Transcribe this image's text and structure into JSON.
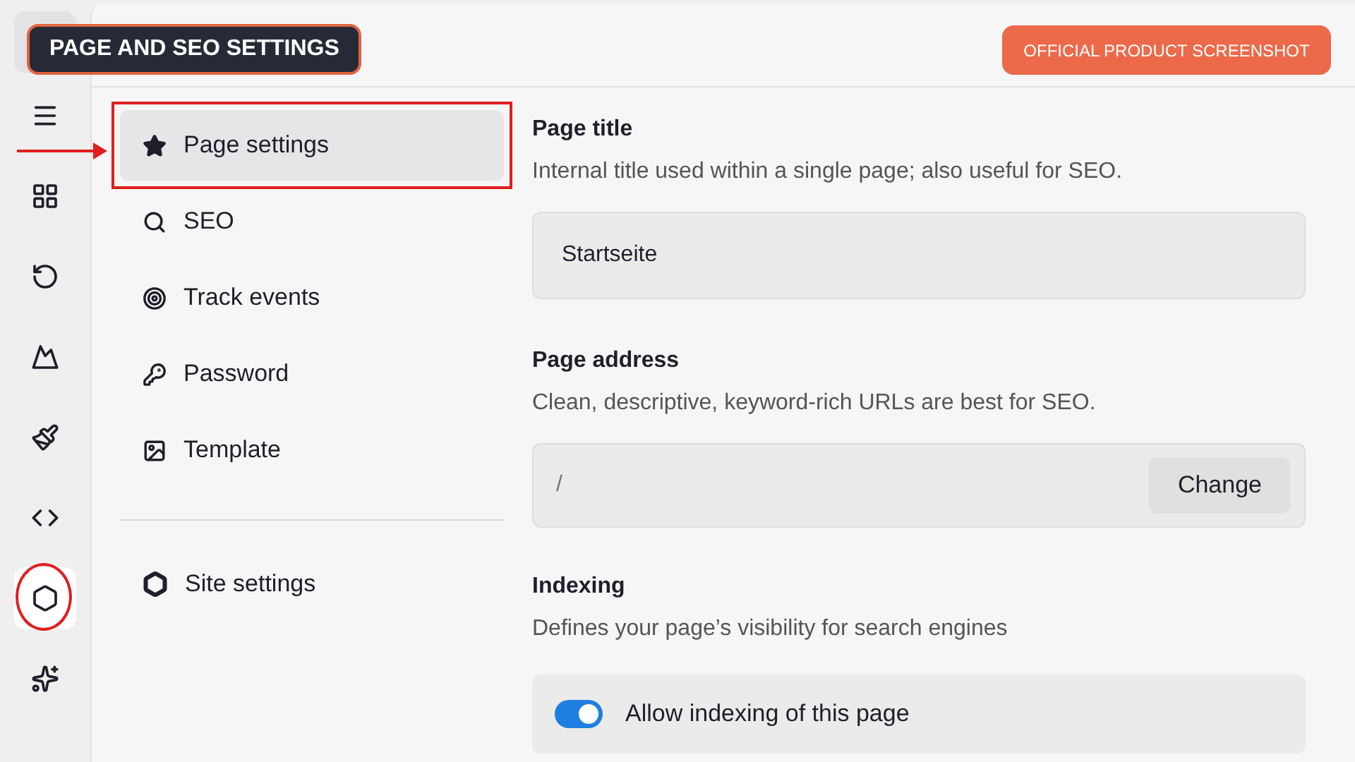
{
  "annotation": {
    "label": "PAGE AND SEO SETTINGS",
    "badge": "OFFICIAL PRODUCT SCREENSHOT"
  },
  "rail": [
    {
      "selected": false
    },
    {
      "selected": false
    },
    {
      "selected": false
    },
    {
      "selected": false
    },
    {
      "selected": false
    },
    {
      "selected": false
    },
    {
      "selected": true
    },
    {
      "selected": false
    }
  ],
  "nav": [
    {
      "label": "Page settings",
      "selected": true
    },
    {
      "label": "SEO",
      "selected": false
    },
    {
      "label": "Track events",
      "selected": false
    },
    {
      "label": "Password",
      "selected": false
    },
    {
      "label": "Template",
      "selected": false
    }
  ],
  "site_settings": {
    "label": "Site settings"
  },
  "page_title": {
    "heading": "Page title",
    "hint": "Internal title used within a single page; also useful for SEO.",
    "value": "Startseite"
  },
  "page_address": {
    "heading": "Page address",
    "hint": "Clean, descriptive, keyword-rich URLs are best for SEO.",
    "value": "/",
    "button": "Change"
  },
  "indexing": {
    "heading": "Indexing",
    "hint": "Defines your page’s visibility for search engines",
    "toggle_label": "Allow indexing of this page",
    "on": true
  }
}
